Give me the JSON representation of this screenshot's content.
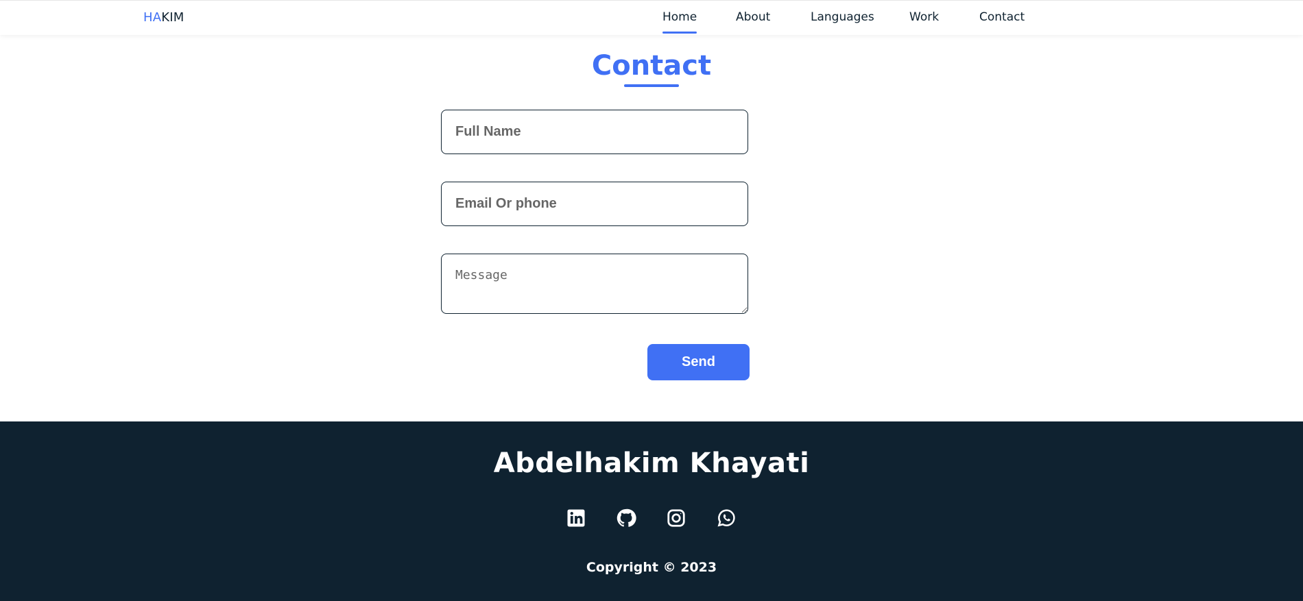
{
  "header": {
    "logo_accent": "HA",
    "logo_rest": "KIM",
    "nav": [
      {
        "label": "Home",
        "active": true
      },
      {
        "label": "About",
        "active": false
      },
      {
        "label": "Languages",
        "active": false
      },
      {
        "label": "Work",
        "active": false
      },
      {
        "label": "Contact",
        "active": false
      }
    ]
  },
  "contact": {
    "title": "Contact",
    "name_placeholder": "Full Name",
    "email_placeholder": "Email Or phone",
    "message_placeholder": "Message",
    "send_label": "Send"
  },
  "footer": {
    "name": "Abdelhakim Khayati",
    "socials": [
      "linkedin-icon",
      "github-icon",
      "instagram-icon",
      "whatsapp-icon"
    ],
    "copyright": "Copyright © 2023"
  },
  "colors": {
    "accent": "#4070f4",
    "dark": "#0f2230"
  }
}
